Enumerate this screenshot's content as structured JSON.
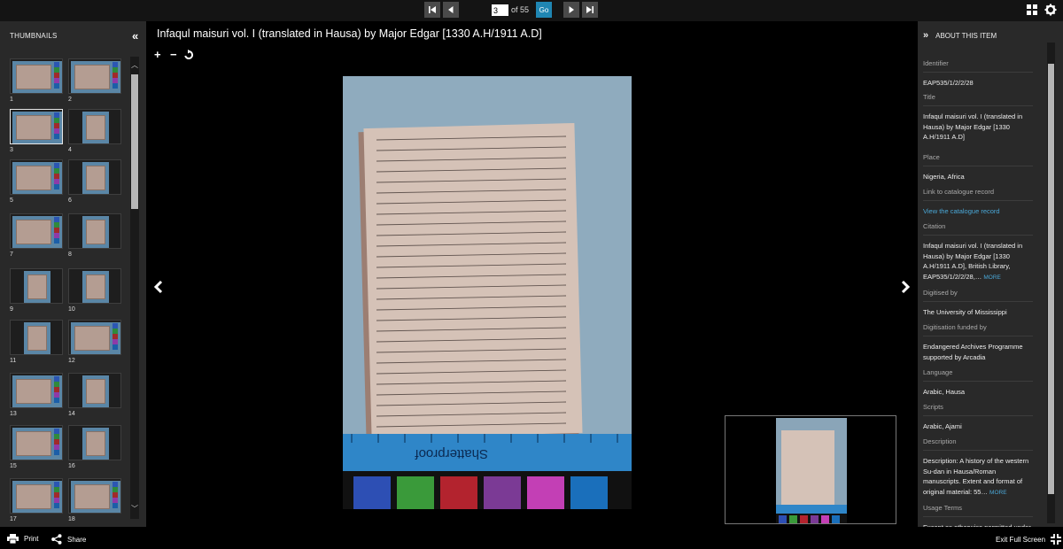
{
  "toolbar": {
    "page_value": "3",
    "page_of": "of 55",
    "go_label": "Go",
    "icons": [
      "first-page-icon",
      "prev-page-icon",
      "next-page-icon",
      "last-page-icon",
      "gallery-icon",
      "settings-icon"
    ]
  },
  "thumbnails": {
    "title": "THUMBNAILS",
    "selected_index": 3,
    "items": [
      {
        "num": "1"
      },
      {
        "num": "2"
      },
      {
        "num": "3"
      },
      {
        "num": "4"
      },
      {
        "num": "5"
      },
      {
        "num": "6"
      },
      {
        "num": "7"
      },
      {
        "num": "8"
      },
      {
        "num": "9"
      },
      {
        "num": "10"
      },
      {
        "num": "11"
      },
      {
        "num": "12"
      },
      {
        "num": "13"
      },
      {
        "num": "14"
      },
      {
        "num": "15"
      },
      {
        "num": "16"
      },
      {
        "num": "17"
      },
      {
        "num": "18"
      }
    ]
  },
  "viewer": {
    "title": "Infaqul maisuri vol. I (translated in Hausa) by Major Edgar [1330 A.H/1911 A.D]",
    "zoom_in": "+",
    "zoom_out": "−",
    "ruler_text": "Shatterproof"
  },
  "about": {
    "title": "ABOUT THIS ITEM",
    "fields": [
      {
        "label": "Identifier",
        "value": "EAP535/1/2/2/28"
      },
      {
        "label": "Title",
        "value": "Infaqul maisuri vol. I (translated in Hausa) by Major Edgar [1330 A.H/1911 A.D]"
      },
      {
        "label": "Place",
        "value": "Nigeria, Africa"
      },
      {
        "label": "Link to catalogue record",
        "value": "View the catalogue record"
      },
      {
        "label": "Citation",
        "value": "Infaqul maisuri vol. I (translated in Hausa) by Major Edgar [1330 A.H/1911 A.D], British Library, EAP535/1/2/2/28,…",
        "more": "MORE"
      },
      {
        "label": "Digitised by",
        "value": "The University of Mississippi"
      },
      {
        "label": "Digitisation funded by",
        "value": "Endangered Archives Programme supported by Arcadia"
      },
      {
        "label": "Language",
        "value": "Arabic, Hausa"
      },
      {
        "label": "Scripts",
        "value": "Arabic, Ajami"
      },
      {
        "label": "Description",
        "value": "Description: A history of the western Su-dan in Hausa/Roman manuscripts. Extent and format of original material: 55…",
        "more": "MORE"
      },
      {
        "label": "Usage Terms",
        "value": "Except as otherwise permitted under"
      }
    ]
  },
  "footer": {
    "print_label": "Print",
    "share_label": "Share",
    "exit_label": "Exit Full Screen"
  },
  "colors": {
    "accent": "#1f86b3",
    "link": "#4aa8d8",
    "panel": "#292929"
  }
}
